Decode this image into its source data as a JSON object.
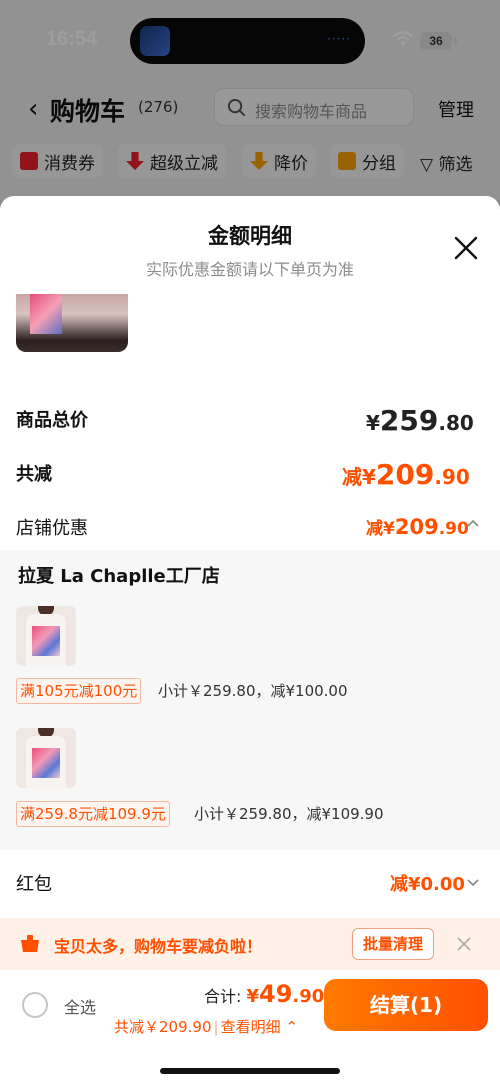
{
  "status_bar": {
    "time": "16:54",
    "island_dots": "·····",
    "battery": "36"
  },
  "nav": {
    "title": "购物车",
    "count": "(276)",
    "search_placeholder": "搜索购物车商品",
    "manage": "管理"
  },
  "filters": [
    {
      "label": "消费券",
      "icon": "coupon-icon",
      "color": "#e8212b"
    },
    {
      "label": "超级立减",
      "icon": "arrow-down-icon",
      "color": "#e8212b"
    },
    {
      "label": "降价",
      "icon": "price-drop-icon",
      "color": "#f5a000"
    },
    {
      "label": "分组",
      "icon": "folder-icon",
      "color": "#f5a000"
    }
  ],
  "filter_plain": {
    "label": "筛选",
    "icon": "filter-icon"
  },
  "sheet": {
    "title": "金额明细",
    "subtitle": "实际优惠金额请以下单页为准",
    "total_label": "商品总价",
    "total_symbol": "¥",
    "total_int": "259",
    "total_dec": ".80",
    "reduce_label": "共减",
    "reduce_prefix": "减¥",
    "reduce_int": "209",
    "reduce_dec": ".90",
    "shop_discount_label": "店铺优惠",
    "shop_discount_prefix": "减¥",
    "shop_discount_int": "209",
    "shop_discount_dec": ".90",
    "shop_name": "拉夏 La Chaplle工厂店",
    "items": [
      {
        "promo": "满105元减100元",
        "subtotal": "小计￥259.80，减¥100.00"
      },
      {
        "promo": "满259.8元减109.9元",
        "subtotal": "小计￥259.80，减¥109.90"
      }
    ],
    "red_packet_label": "红包",
    "red_packet_value": "减¥0.00"
  },
  "notice": {
    "text": "宝贝太多，购物车要减负啦！",
    "button": "批量清理"
  },
  "checkout": {
    "select_all": "全选",
    "sum_label": "合计: ",
    "sum_symbol": "¥",
    "sum_int": "49",
    "sum_dec": ".90",
    "reduce_text": "共减￥209.90",
    "separator": "|",
    "detail_link": "查看明细",
    "button": "结算(1)"
  },
  "colors": {
    "accent": "#ff5000",
    "notice_bg": "#fff1e8"
  }
}
